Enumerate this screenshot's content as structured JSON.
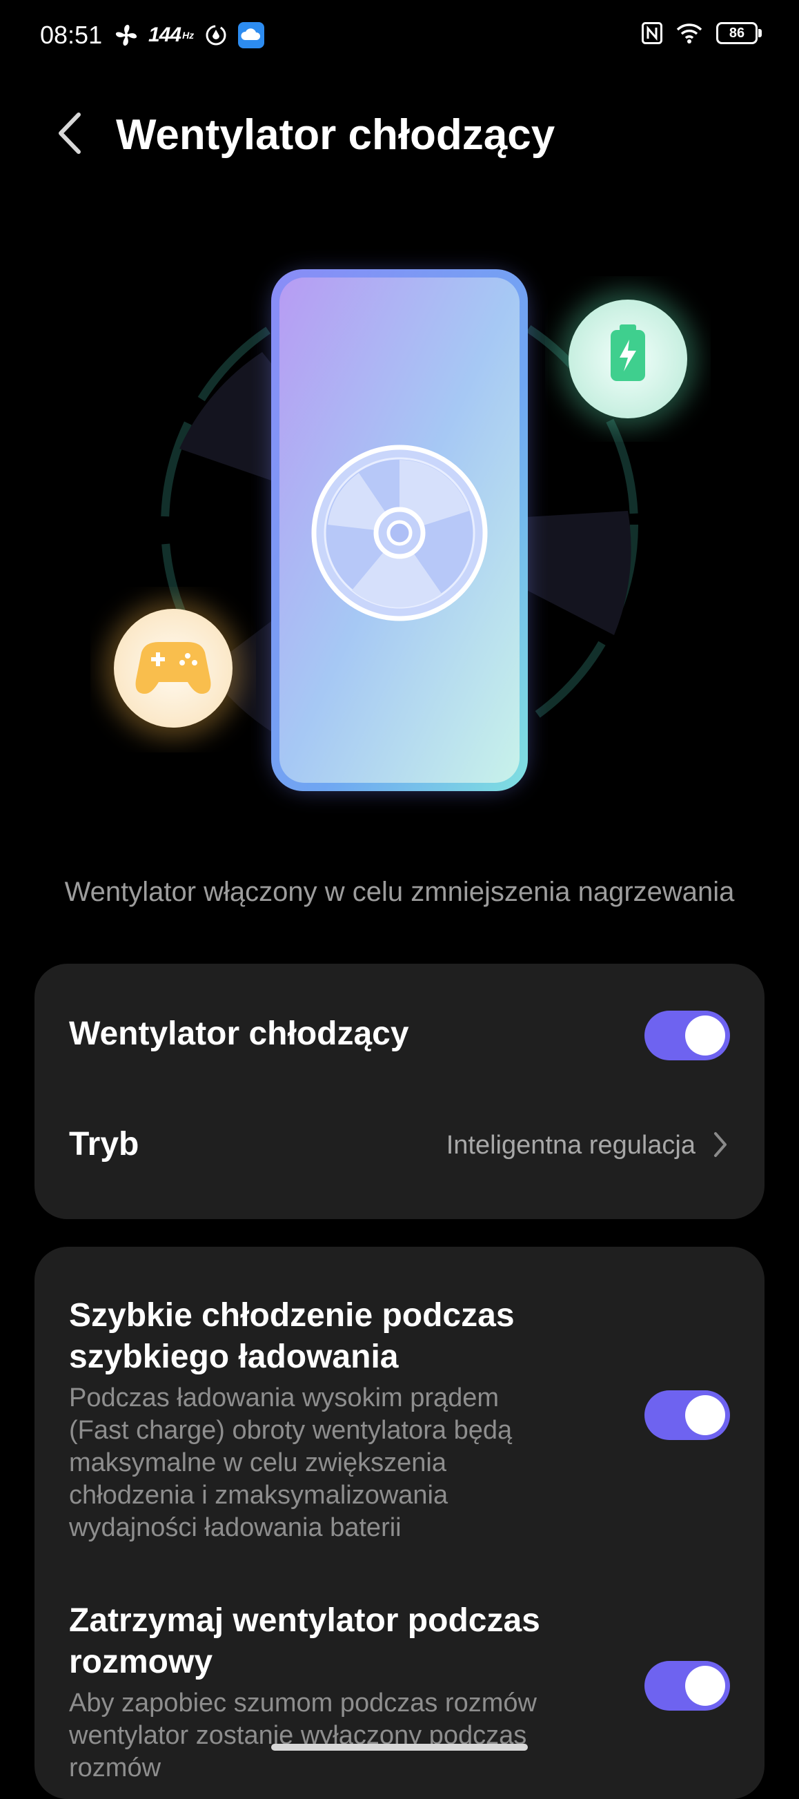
{
  "status_bar": {
    "time": "08:51",
    "refresh_rate": "144",
    "refresh_unit": "Hz",
    "battery_level": "86",
    "icons_left": [
      "fan-icon",
      "refresh-rate-icon",
      "data-saver-icon",
      "cloud-icon"
    ],
    "icons_right": [
      "nfc-icon",
      "wifi-icon",
      "battery-icon"
    ]
  },
  "header": {
    "title": "Wentylator chłodzący"
  },
  "subtitle": "Wentylator włączony w celu zmniejszenia nagrzewania",
  "card_main": {
    "fan_toggle_label": "Wentylator chłodzący",
    "fan_toggle_on": true,
    "mode_label": "Tryb",
    "mode_value": "Inteligentna regulacja"
  },
  "options": [
    {
      "title": "Szybkie chłodzenie podczas szybkiego ładowania",
      "description": "Podczas ładowania wysokim prądem (Fast charge) obroty wentylatora będą maksymalne w celu zwiększenia chłodzenia i zmaksymalizowania wydajności ładowania baterii",
      "enabled": true
    },
    {
      "title": "Zatrzymaj wentylator podczas rozmowy",
      "description": "Aby zapobiec szumom podczas rozmów wentylator zostanie wyłączony podczas rozmów",
      "enabled": true
    }
  ],
  "colors": {
    "background": "#000000",
    "card": "#1f1f1f",
    "toggle_on": "#6e63f0",
    "secondary_text": "#9d9d9d"
  }
}
